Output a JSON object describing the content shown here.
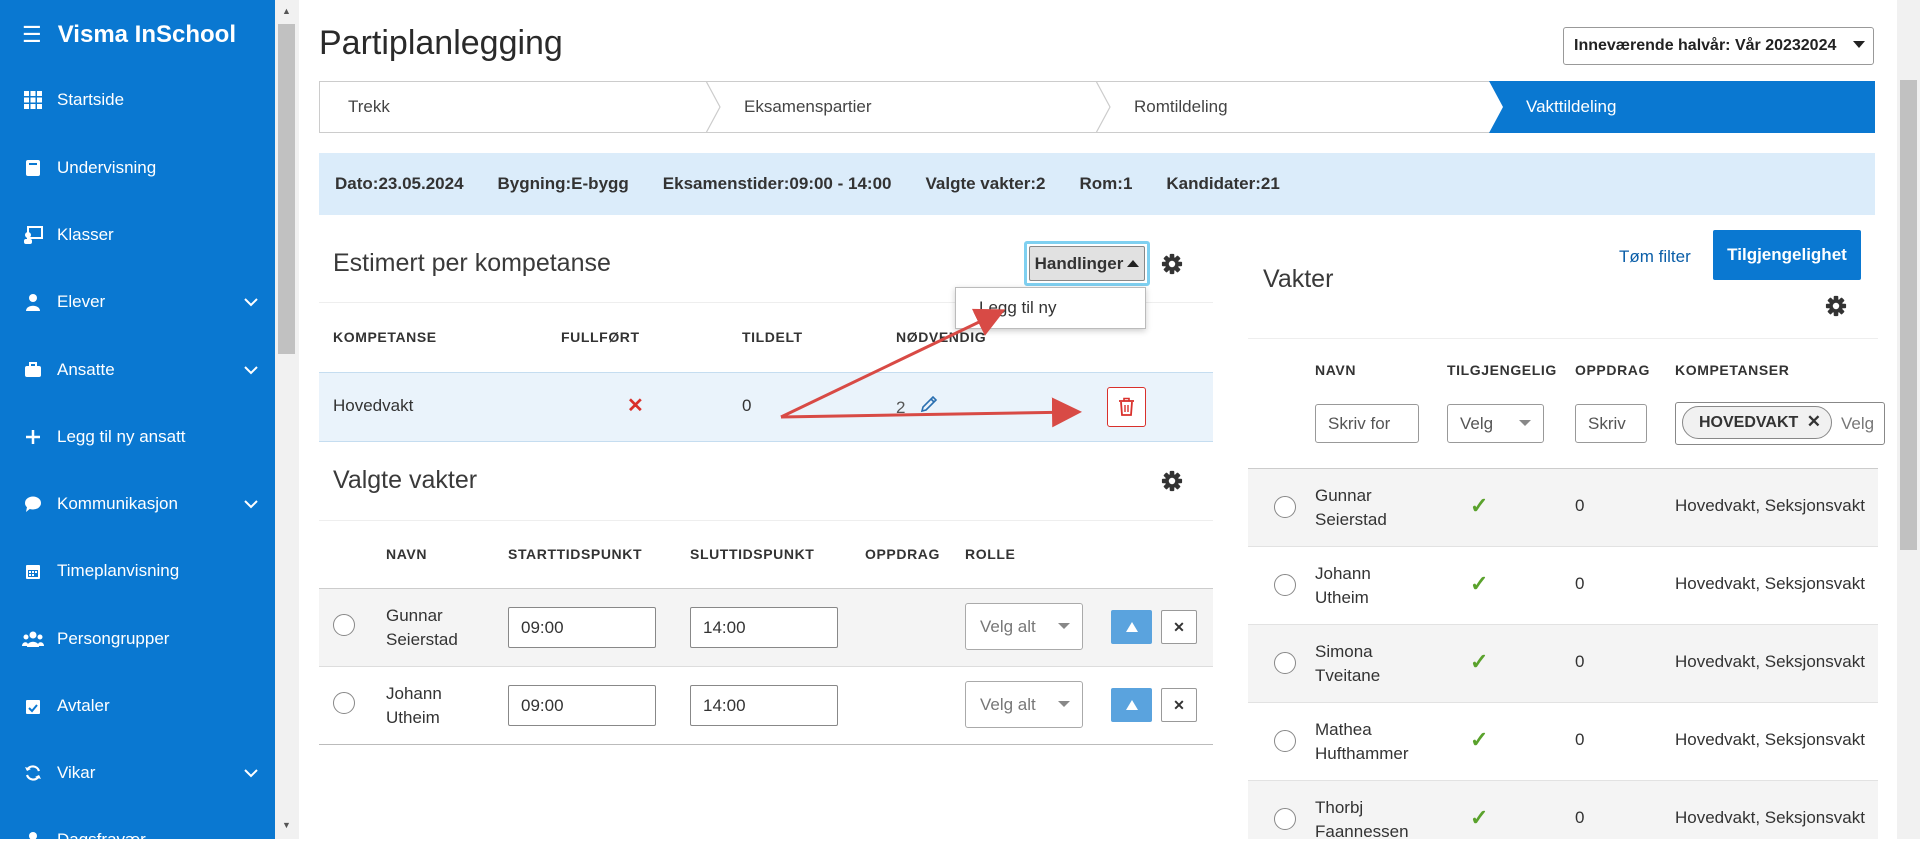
{
  "app": {
    "title": "Visma InSchool"
  },
  "sidebar": {
    "items": [
      {
        "label": "Startside",
        "icon": "grid-icon"
      },
      {
        "label": "Undervisning",
        "icon": "book-icon"
      },
      {
        "label": "Klasser",
        "icon": "class-icon"
      },
      {
        "label": "Elever",
        "icon": "student-icon",
        "expand": true
      },
      {
        "label": "Ansatte",
        "icon": "briefcase-icon",
        "expand": true
      },
      {
        "label": "Legg til ny ansatt",
        "icon": "plus-icon"
      },
      {
        "label": "Kommunikasjon",
        "icon": "chat-icon",
        "expand": true
      },
      {
        "label": "Timeplanvisning",
        "icon": "calendar-icon"
      },
      {
        "label": "Persongrupper",
        "icon": "group-icon"
      },
      {
        "label": "Avtaler",
        "icon": "calendar-check-icon"
      },
      {
        "label": "Vikar",
        "icon": "refresh-icon",
        "expand": true
      },
      {
        "label": "Dagsfravær",
        "icon": "person-icon"
      }
    ]
  },
  "header": {
    "title": "Partiplanlegging",
    "period": "Inneværende halvår: Vår 20232024"
  },
  "steps": [
    {
      "label": "Trekk",
      "active": false
    },
    {
      "label": "Eksamenspartier",
      "active": false
    },
    {
      "label": "Romtildeling",
      "active": false
    },
    {
      "label": "Vakttildeling",
      "active": true
    }
  ],
  "info": {
    "date": "Dato:23.05.2024",
    "building": "Bygning:E-bygg",
    "times": "Eksamenstider:09:00 - 14:00",
    "guards": "Valgte vakter:2",
    "rooms": "Rom:1",
    "candidates": "Kandidater:21"
  },
  "competence": {
    "title": "Estimert per kompetanse",
    "actions_label": "Handlinger",
    "menu": [
      "Legg til ny"
    ],
    "columns": [
      "KOMPETANSE",
      "FULLFØRT",
      "TILDELT",
      "NØDVENDIG"
    ],
    "rows": [
      {
        "name": "Hovedvakt",
        "completed": "✕",
        "assigned": "0",
        "required": "2"
      }
    ]
  },
  "selected": {
    "title": "Valgte vakter",
    "columns": [
      "NAVN",
      "STARTTIDSPUNKT",
      "SLUTTIDSPUNKT",
      "OPPDRAG",
      "ROLLE"
    ],
    "role_placeholder": "Velg alt",
    "rows": [
      {
        "name1": "Gunnar",
        "name2": "Seierstad",
        "start": "09:00",
        "end": "14:00"
      },
      {
        "name1": "Johann",
        "name2": "Utheim",
        "start": "09:00",
        "end": "14:00"
      }
    ]
  },
  "guards": {
    "title": "Vakter",
    "clear_filter": "Tøm filter",
    "availability_button": "Tilgjengelighet",
    "columns": [
      "NAVN",
      "TILGJENGELIG",
      "OPPDRAG",
      "KOMPETANSER"
    ],
    "filters": {
      "name": "Skriv for",
      "available": "Velg",
      "assignment": "Skriv",
      "chip": "HOVEDVAKT",
      "comp": "Velg"
    },
    "rows": [
      {
        "name1": "Gunnar",
        "name2": "Seierstad",
        "available": "✓",
        "assignments": "0",
        "competences": "Hovedvakt, Seksjonsvakt"
      },
      {
        "name1": "Johann",
        "name2": "Utheim",
        "available": "✓",
        "assignments": "0",
        "competences": "Hovedvakt, Seksjonsvakt"
      },
      {
        "name1": "Simona",
        "name2": "Tveitane",
        "available": "✓",
        "assignments": "0",
        "competences": "Hovedvakt, Seksjonsvakt"
      },
      {
        "name1": "Mathea",
        "name2": "Hufthammer",
        "available": "✓",
        "assignments": "0",
        "competences": "Hovedvakt, Seksjonsvakt"
      },
      {
        "name1": "Thorbj",
        "name2": "Faannessen",
        "available": "✓",
        "assignments": "0",
        "competences": "Hovedvakt, Seksjonsvakt"
      }
    ]
  },
  "colors": {
    "brand": "#0a78d1",
    "info_bg": "#dbecfa",
    "danger": "#d9302b",
    "check": "#5aa22c",
    "annotation": "#d84a45"
  }
}
